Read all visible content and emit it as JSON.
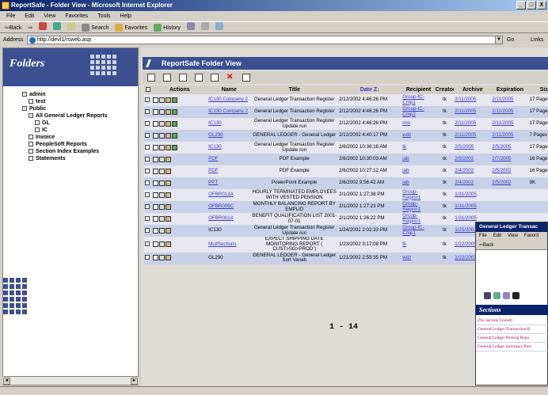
{
  "window": {
    "title": "ReportSafe - Folder View - Microsoft Internet Explorer",
    "min": "_",
    "max": "□",
    "close": "X"
  },
  "menu": [
    "File",
    "Edit",
    "View",
    "Favorites",
    "Tools",
    "Help"
  ],
  "toolbar": {
    "back": "⇦Back",
    "forward": "⇨",
    "search": "Search",
    "favorites": "Favorites",
    "history": "History"
  },
  "address": {
    "label": "Address",
    "value": "http://devl1/rsweb.asp",
    "go": "Go",
    "links": "Links"
  },
  "sidebar": {
    "title": "Folders",
    "tree": [
      {
        "label": "admin",
        "expand": "-",
        "indent": 0
      },
      {
        "label": "test",
        "expand": "",
        "indent": 1
      },
      {
        "label": "Public",
        "expand": "-",
        "indent": 0
      },
      {
        "label": "All General Ledger Reports",
        "expand": "-",
        "indent": 1
      },
      {
        "label": "GL",
        "expand": "",
        "indent": 2
      },
      {
        "label": "IC",
        "expand": "",
        "indent": 2
      },
      {
        "label": "Invoice",
        "expand": "",
        "indent": 1
      },
      {
        "label": "PeopleSoft Reports",
        "expand": "",
        "indent": 1
      },
      {
        "label": "Section Index Examples",
        "expand": "",
        "indent": 1
      },
      {
        "label": "Statements",
        "expand": "",
        "indent": 1
      }
    ]
  },
  "main": {
    "title": "ReportSafe Folder View",
    "columns": {
      "actions": "Actions",
      "name": "Name",
      "title": "Title",
      "date": "Date",
      "date_sort": "Z↓",
      "recipient": "Recipient",
      "creator": "Creator",
      "archive": "Archive",
      "expiration": "Expiration",
      "size": "Size"
    },
    "rows": [
      {
        "name": "IC130 Company 2",
        "title": "General Ledger Transaction Register",
        "date": "2/12/2002 4:46:26 PM",
        "recipient": "Group-IC-Cmp1",
        "creator": "tk",
        "archive": "2/11/2005",
        "expiration": "2/11/2005",
        "size": "17 Pages",
        "link": true
      },
      {
        "name": "IC130 Company 2",
        "title": "General Ledger Transaction Register",
        "date": "2/12/2002 4:46:26 PM",
        "recipient": "Group-IC-Cmp2",
        "creator": "tk",
        "archive": "2/11/2005",
        "expiration": "2/11/2005",
        "size": "17 Pages",
        "link": true
      },
      {
        "name": "IC130",
        "title": "General Ledger Transaction Register Update run",
        "date": "2/12/2002 4:46:26 PM",
        "recipient": "imo",
        "creator": "tk",
        "archive": "2/11/2005",
        "expiration": "2/11/2005",
        "size": "17 Pages",
        "link": true
      },
      {
        "name": "GL290",
        "title": "GENERAL LEDGER - General Ledger",
        "date": "2/12/2002 4:40:17 PM",
        "recipient": "wdz",
        "creator": "tk",
        "archive": "2/11/2005",
        "expiration": "2/11/2005",
        "size": "7 Pages",
        "link": true
      },
      {
        "name": "IC130",
        "title": "General Ledger Transaction Register Update run",
        "date": "2/6/2002 10:36:18 AM",
        "recipient": "tk",
        "creator": "tk",
        "archive": "2/5/2005",
        "expiration": "2/5/2005",
        "size": "17 Pages",
        "link": true
      },
      {
        "name": "PDF",
        "title": "PDF Example",
        "date": "2/6/2002 10:30:03 AM",
        "recipient": "jab",
        "creator": "tk",
        "archive": "2/5/2002",
        "expiration": "2/7/2005",
        "size": "16 Pages",
        "link": true
      },
      {
        "name": "PDF",
        "title": "PDF Example",
        "date": "2/6/2002 10:27:12 AM",
        "recipient": "jab",
        "creator": "tk",
        "archive": "2/4/2002",
        "expiration": "2/5/2002",
        "size": "16 Pages",
        "link": true
      },
      {
        "name": "PPT",
        "title": "PowerPoint Example",
        "date": "2/6/2002 9:56:42 AM",
        "recipient": "jab",
        "creator": "tk",
        "archive": "2/4/2002",
        "expiration": "2/5/2002",
        "size": "9K",
        "link": true
      },
      {
        "name": "OFBR013A",
        "title": "HOURLY TERMINATED EMPLOYEES WITH VESTED PENSION",
        "date": "2/1/2002 1:27:38 PM",
        "recipient": "Group-Region1",
        "creator": "tk",
        "archive": "1/31/2005",
        "expiration": "",
        "size": "",
        "link": true
      },
      {
        "name": "OFBR006C",
        "title": "MONTHLY BALANCING REPORT BY EMPLID",
        "date": "2/1/2002 1:27:23 PM",
        "recipient": "Group-Region1",
        "creator": "tk",
        "archive": "1/31/2005",
        "expiration": "",
        "size": "",
        "link": true
      },
      {
        "name": "OFBR001A",
        "title": "BENEFIT QUALIFICATION LIST 2001-07-01",
        "date": "2/1/2002 1:26:22 PM",
        "recipient": "Group-Region1",
        "creator": "tk",
        "archive": "1/31/2005",
        "expiration": "",
        "size": "",
        "link": true
      },
      {
        "name": "IC130",
        "title": "General Ledger Transaction Register Update run",
        "date": "1/24/2002 2:02:33 PM",
        "recipient": "Group-IC-Cmp1",
        "creator": "tk",
        "archive": "1/25/2002",
        "expiration": "",
        "size": "",
        "link": false
      },
      {
        "name": "MultSections",
        "title": "EXPECT SHIPPING DATE MONITORING REPORT ( CUST>SG>PROD )",
        "date": "1/23/2002 3:17:08 PM",
        "recipient": "tk",
        "creator": "tk",
        "archive": "1/22/2005",
        "expiration": "",
        "size": "",
        "link": true
      },
      {
        "name": "GL290",
        "title": "GENERAL LEDGER - General Ledger Sort Variab",
        "date": "1/21/2002 2:55:35 PM",
        "recipient": "wdz",
        "creator": "tk",
        "archive": "1/22/2002",
        "expiration": "",
        "size": "",
        "link": false
      }
    ],
    "pager": "1 - 14"
  },
  "popup": {
    "title": "General Ledger Transac",
    "menu": [
      "File",
      "Edit",
      "View",
      "Favorit"
    ],
    "back": "⇦Back",
    "section_title": "Sections",
    "sections": [
      "(No Section Found)",
      "General Ledger Transaction R",
      "General Ledger Posting Repo",
      "General Ledger Summary Post"
    ]
  },
  "colors": {
    "header": "#3b4f91",
    "titlebar": "#0a246a",
    "link": "#3a3ac0",
    "row_even": "#c9d1e8",
    "row_odd": "#e8e6ef"
  }
}
